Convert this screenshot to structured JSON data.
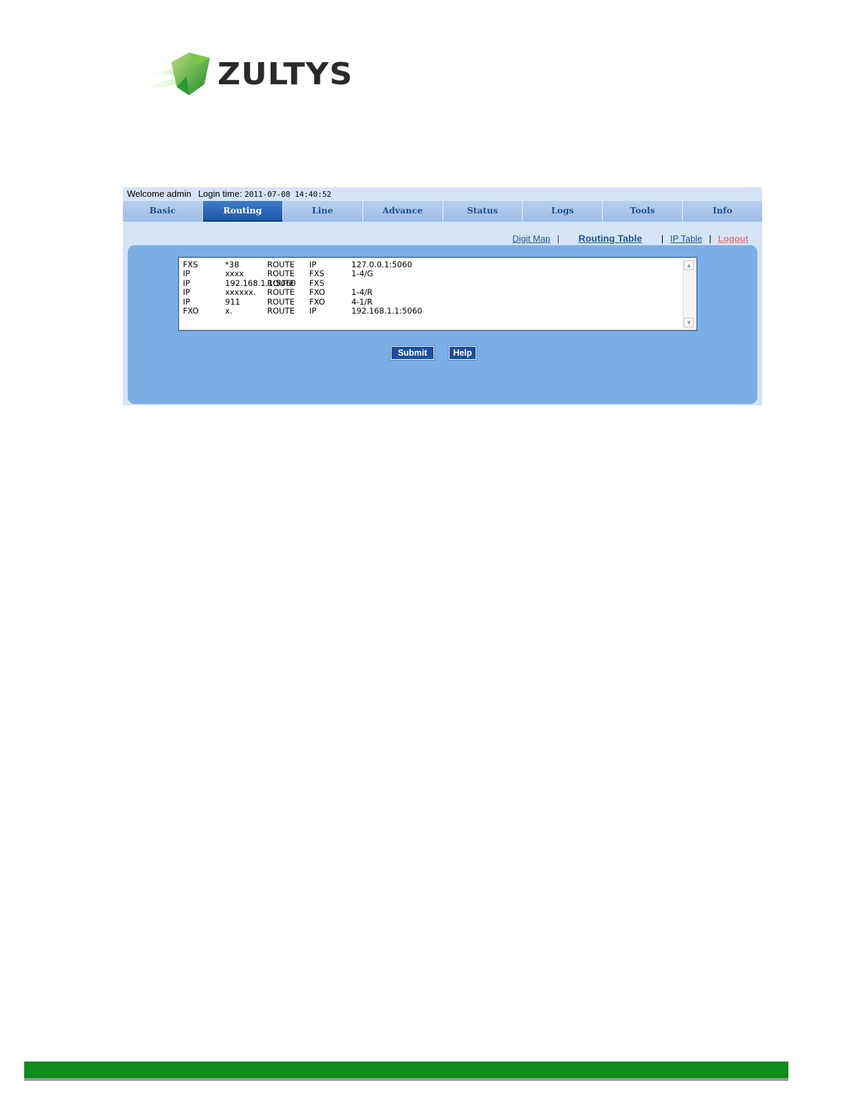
{
  "brand": {
    "name": "ZULTYS"
  },
  "header": {
    "welcome": "Welcome admin",
    "login_label": "Login time:",
    "login_time": "2011-07-08 14:40:52"
  },
  "tabs": [
    {
      "label": "Basic"
    },
    {
      "label": "Routing",
      "active": true
    },
    {
      "label": "Line"
    },
    {
      "label": "Advance"
    },
    {
      "label": "Status"
    },
    {
      "label": "Logs"
    },
    {
      "label": "Tools"
    },
    {
      "label": "Info"
    }
  ],
  "subnav": {
    "digit_map": "Digit Map",
    "routing_table": "Routing Table",
    "ip_table": "IP Table",
    "logout": "Logout",
    "separator": "|"
  },
  "routes": [
    [
      "FXS",
      "*38",
      "ROUTE",
      "IP",
      "127.0.0.1:5060"
    ],
    [
      "IP",
      "xxxx",
      "ROUTE",
      "FXS",
      "1-4/G"
    ],
    [
      "IP",
      "192.168.1.1:5060",
      "ROUTE",
      "FXS",
      ""
    ],
    [
      "IP",
      "xxxxxx.",
      "ROUTE",
      "FXO",
      "1-4/R"
    ],
    [
      "IP",
      "911",
      "ROUTE",
      "FXO",
      "4-1/R"
    ],
    [
      "FXO",
      "x.",
      "ROUTE",
      "IP",
      "192.168.1.1:5060"
    ]
  ],
  "buttons": {
    "submit": "Submit",
    "help": "Help"
  },
  "colors": {
    "accent": "#1e4f9a",
    "panel": "#7caee6",
    "footer": "#0d8c1a",
    "logout": "#e87a7a"
  }
}
